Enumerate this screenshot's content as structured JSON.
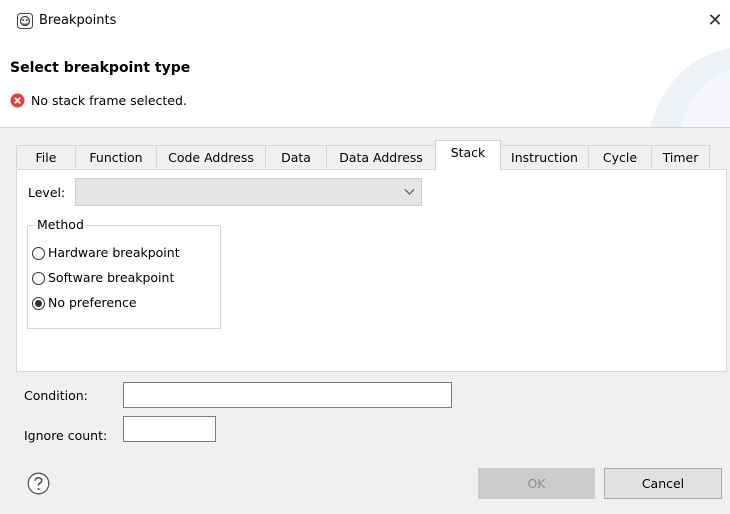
{
  "window": {
    "title": "Breakpoints",
    "close_glyph": "✕"
  },
  "header": {
    "title": "Select breakpoint type",
    "error_message": "No stack frame selected."
  },
  "tabs": [
    {
      "label": "File"
    },
    {
      "label": "Function"
    },
    {
      "label": "Code Address"
    },
    {
      "label": "Data"
    },
    {
      "label": "Data Address"
    },
    {
      "label": "Stack",
      "active": true
    },
    {
      "label": "Instruction"
    },
    {
      "label": "Cycle"
    },
    {
      "label": "Timer"
    }
  ],
  "panel": {
    "level_label": "Level:",
    "level_value": "",
    "method": {
      "legend": "Method",
      "options": [
        {
          "label": "Hardware breakpoint",
          "checked": false
        },
        {
          "label": "Software breakpoint",
          "checked": false
        },
        {
          "label": "No preference",
          "checked": true
        }
      ]
    }
  },
  "condition": {
    "label": "Condition:",
    "value": ""
  },
  "ignore_count": {
    "label": "Ignore count:",
    "value": ""
  },
  "buttons": {
    "ok": "OK",
    "cancel": "Cancel"
  },
  "icons": {
    "app": "breakpoints-app-icon",
    "error": "error-icon",
    "help": "help-icon",
    "dropdown": "chevron-down-icon"
  },
  "colors": {
    "error": "#e0443e",
    "disabled_button": "#cccccc",
    "header_accent": "#e8eef8"
  }
}
